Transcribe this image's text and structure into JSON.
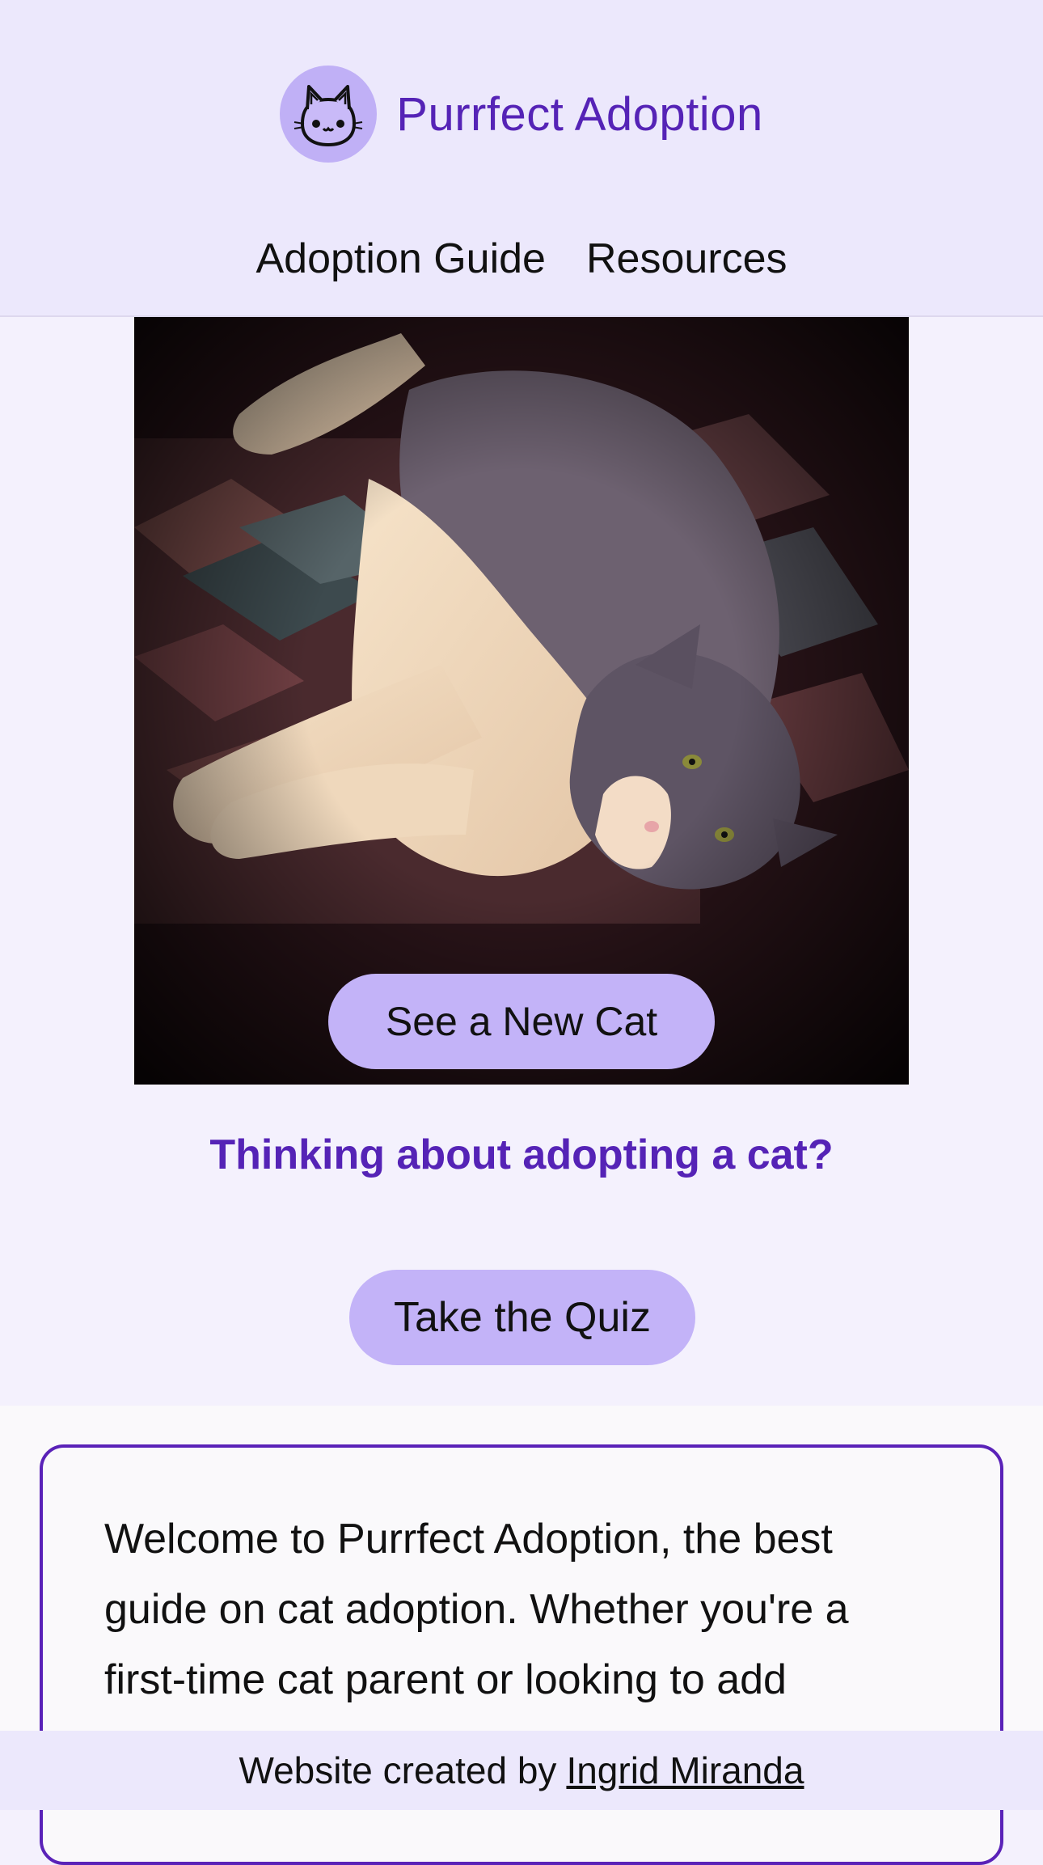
{
  "header": {
    "logo_icon": "cat-face-icon",
    "title": "Purrfect Adoption",
    "nav": [
      {
        "label": "Adoption Guide"
      },
      {
        "label": "Resources"
      }
    ]
  },
  "hero": {
    "image_subject": "gray and white cat lying on patterned rug",
    "new_cat_button": "See a New Cat"
  },
  "cta": {
    "question": "Thinking about adopting a cat?",
    "quiz_button": "Take the Quiz"
  },
  "welcome": {
    "text": "Welcome to Purrfect Adoption, the best guide on cat adoption. Whether you're a first-time cat parent or looking to add"
  },
  "footer": {
    "prefix": "Website created by",
    "author": "Ingrid Miranda"
  },
  "colors": {
    "accent": "#5523b6",
    "button": "#c3b3f8",
    "header_bg": "#ece8fc"
  }
}
